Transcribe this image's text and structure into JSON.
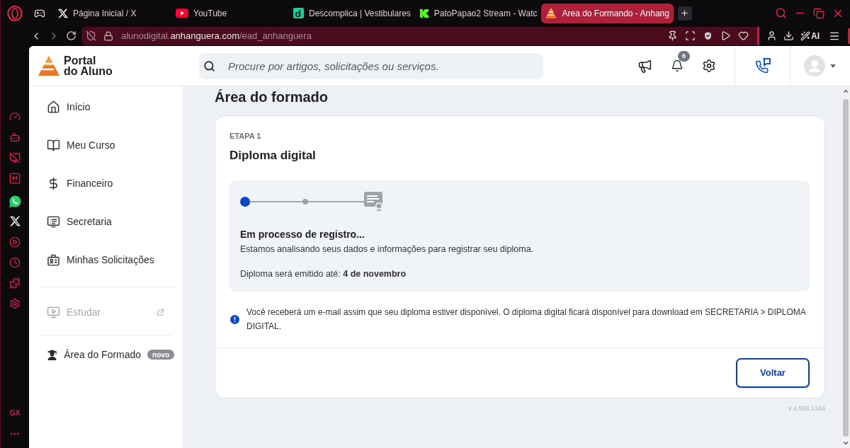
{
  "browser": {
    "tabs": [
      {
        "title": "Página Inicial / X",
        "selected": false
      },
      {
        "title": "YouTube",
        "selected": false
      },
      {
        "title": "Descomplica | Vestibulares",
        "selected": false
      },
      {
        "title": "PatoPapao2 Stream - Watc",
        "selected": false
      },
      {
        "title": "Area do Formando - Anhang",
        "selected": true
      }
    ],
    "address": "alunodigital.**anhanguera.com**/ead_anhanguera",
    "ai_label": "AI"
  },
  "browser_sidebar": {
    "label": "GX"
  },
  "header": {
    "logo_lines": [
      "Portal",
      "do Aluno"
    ],
    "search": {
      "placeholder": "Procure por artigos, solicitações ou serviços."
    },
    "notification_count": "6"
  },
  "sidebar": {
    "groups": [
      {
        "items": [
          {
            "label": "Início",
            "disabled": false,
            "external": false
          },
          {
            "label": "Meu Curso",
            "disabled": false,
            "external": false
          },
          {
            "label": "Financeiro",
            "disabled": false,
            "external": false
          },
          {
            "label": "Secretaria",
            "disabled": false,
            "external": false
          },
          {
            "label": "Minhas Solicitações",
            "disabled": false,
            "external": false
          }
        ]
      },
      {
        "items": [
          {
            "label": "Estudar",
            "disabled": true,
            "external": true
          }
        ]
      },
      {
        "items": [
          {
            "label": "Área do Formado",
            "disabled": false,
            "external": false,
            "badge": "novo"
          }
        ]
      }
    ]
  },
  "page": {
    "title": "Área do formado",
    "card": {
      "step_label": "ETAPA 1",
      "title": "Diploma digital",
      "stepper": [
        {
          "active": true
        },
        {
          "active": false
        },
        {
          "active": false
        }
      ],
      "status": {
        "heading": "Em processo de registro...",
        "text": "Estamos analisando seus dados e informações para registrar seu diploma.",
        "deadline": "Diploma será emitido até: **4 de novembro**"
      },
      "notice": "Você receberá um e-mail assim que seu diploma estiver disponível. O diploma digital ficará disponível para download em SECRETARIA > DIPLOMA DIGITAL.",
      "button": "Voltar"
    },
    "version": "v 4.506.1344"
  }
}
